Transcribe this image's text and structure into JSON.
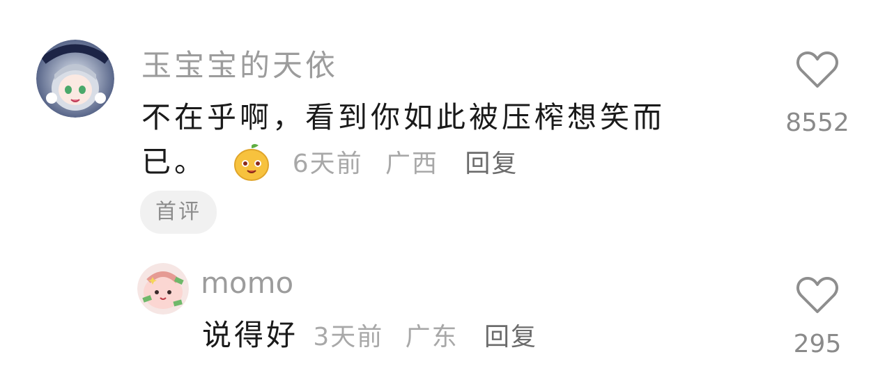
{
  "comments": [
    {
      "username": "玉宝宝的天依",
      "text": "不在乎啊，看到你如此被压榨想笑而已。",
      "time": "6天前",
      "location": "广西",
      "reply_label": "回复",
      "badge": "首评",
      "likes": "8552",
      "avatar_icon": "anime-girl-avatar",
      "emoji_icon": "mango-emoji"
    },
    {
      "username": "momo",
      "text": "说得好",
      "time": "3天前",
      "location": "广东",
      "reply_label": "回复",
      "likes": "295",
      "avatar_icon": "pink-cartoon-avatar"
    }
  ]
}
